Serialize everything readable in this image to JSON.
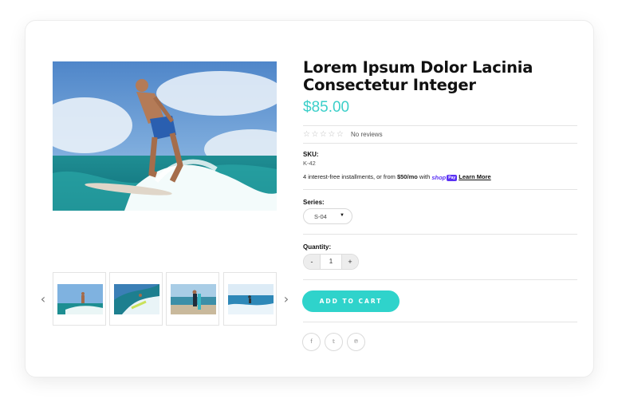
{
  "product": {
    "title": "Lorem Ipsum Dolor Lacinia Consectetur Integer",
    "price": "$85.00",
    "rating": {
      "stars": "☆☆☆☆☆",
      "text": "No reviews"
    },
    "sku": {
      "label": "SKU:",
      "value": "K-42"
    },
    "installments": {
      "prefix": "4 interest-free installments, or from ",
      "amount": "$50/mo",
      "middle": " with ",
      "brand": "shop",
      "brand_badge": "Pay",
      "link": "Learn More"
    },
    "series": {
      "label": "Series:",
      "selected": "S-04"
    },
    "quantity": {
      "label": "Quantity:",
      "minus": "-",
      "value": "1",
      "plus": "+"
    },
    "add_to_cart": "ADD TO CART"
  },
  "gallery": {
    "prev": "‹",
    "next": "›",
    "hero_icon": "surfer-photo",
    "thumbnails": [
      "surfer-thumb-1",
      "surfer-thumb-2",
      "surfer-thumb-3",
      "surfer-thumb-4"
    ]
  },
  "social": {
    "facebook": "f",
    "twitter": "𝕥",
    "pinterest": "℗"
  },
  "colors": {
    "accent": "#2fd3cb",
    "price": "#3bcfc9",
    "shop_pay": "#5a31f4"
  }
}
